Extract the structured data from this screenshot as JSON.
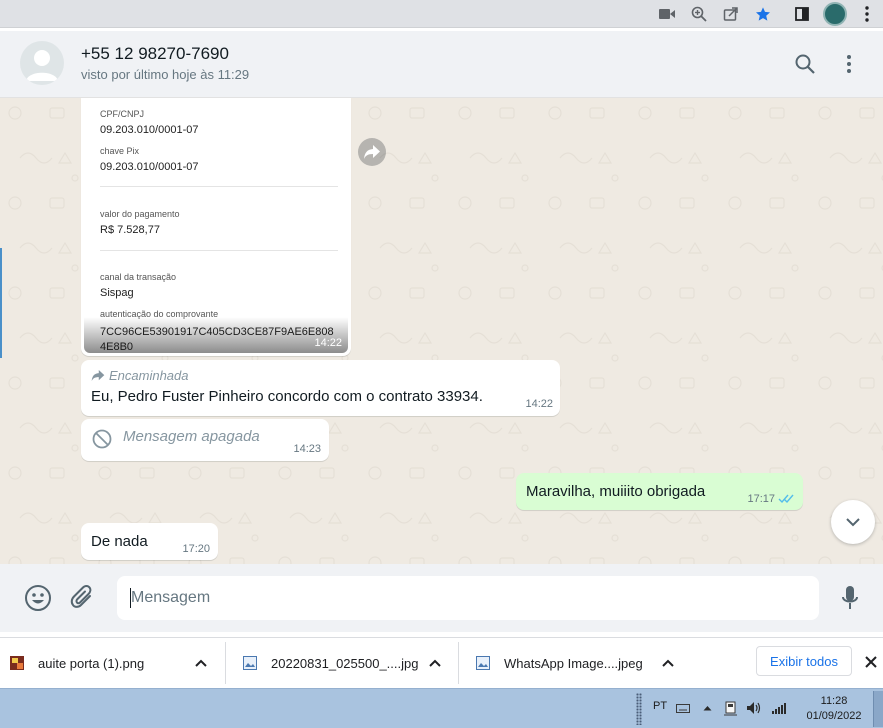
{
  "browser": {
    "icons": [
      "video-camera-icon",
      "zoom-icon",
      "share-icon",
      "bookmark-star-icon",
      "sidebar-icon",
      "profile-avatar",
      "more-icon"
    ],
    "accent_color": "#1a73e8"
  },
  "chat": {
    "contact_name": "+55 12 98270-7690",
    "last_seen": "visto por último hoje às 11:29",
    "header_icons": [
      "search-icon",
      "menu-icon"
    ]
  },
  "receipt": {
    "cpf_label": "CPF/CNPJ",
    "cpf_value": "09.203.010/0001-07",
    "pix_label": "chave Pix",
    "pix_value": "09.203.010/0001-07",
    "amount_label": "valor do pagamento",
    "amount_value": "R$ 7.528,77",
    "channel_label": "canal da transação",
    "channel_value": "Sispag",
    "auth_label": "autenticação do comprovante",
    "auth_code": "7CC96CE53901917C405CD3CE87F9AE6E808 4E8B0",
    "time": "14:22"
  },
  "messages": [
    {
      "forwarded_label": "Encaminhada",
      "text": "Eu, Pedro Fuster Pinheiro concordo com o contrato 33934.",
      "time": "14:22"
    },
    {
      "deleted_text": "Mensagem apagada",
      "time": "14:23"
    },
    {
      "text": "Maravilha, muiiito obrigada",
      "time": "17:17",
      "status": "read"
    },
    {
      "text": "De nada",
      "time": "17:20"
    }
  ],
  "compose": {
    "placeholder": "Mensagem"
  },
  "downloads": {
    "items": [
      {
        "name": "auite porta  (1).png"
      },
      {
        "name": "20220831_025500_....jpg"
      },
      {
        "name": "WhatsApp Image....jpeg"
      }
    ],
    "show_all": "Exibir todos"
  },
  "taskbar": {
    "language": "PT",
    "time": "11:28",
    "date": "01/09/2022"
  },
  "colors": {
    "outgoing_bubble": "#d9fdd3",
    "incoming_bubble": "#ffffff",
    "chat_background": "#efeae2",
    "read_ticks": "#53bdeb"
  }
}
